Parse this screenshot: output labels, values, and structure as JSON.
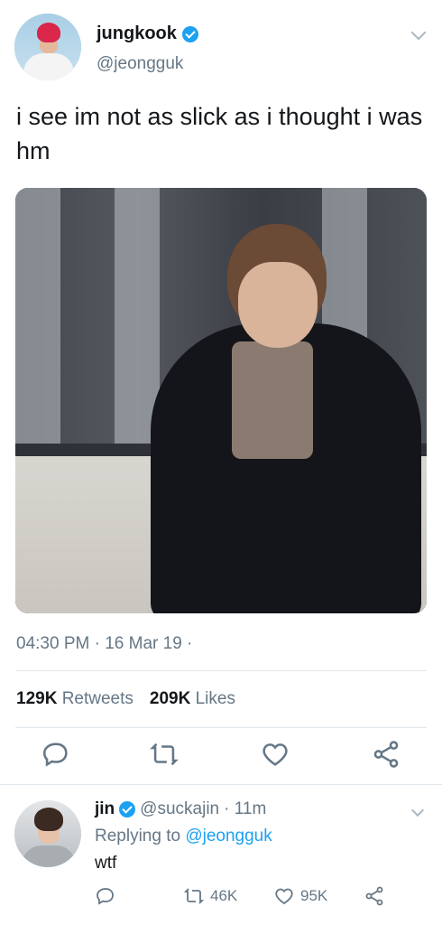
{
  "tweet": {
    "display_name": "jungkook",
    "handle": "@jeongguk",
    "text": "i see im not as slick as i thought i was hm",
    "timestamp": "04:30 PM · 16 Mar 19 ·",
    "retweets_count": "129K",
    "retweets_label": "Retweets",
    "likes_count": "209K",
    "likes_label": "Likes"
  },
  "reply": {
    "display_name": "jin",
    "handle": "@suckajin",
    "time": "· 11m",
    "replying_prefix": "Replying to",
    "replying_to": "@jeongguk",
    "text": "wtf",
    "retweets": "46K",
    "likes": "95K"
  },
  "colors": {
    "accent": "#1da1f2",
    "secondary_text": "#657786",
    "primary_text": "#14171a",
    "divider": "#e1e8ed"
  }
}
